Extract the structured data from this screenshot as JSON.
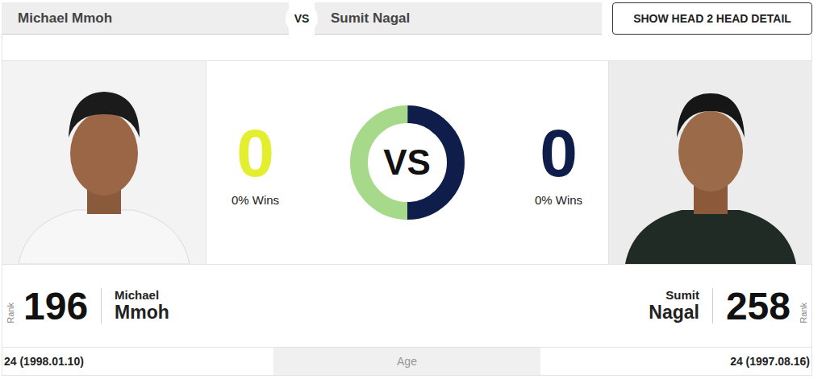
{
  "players": [
    {
      "name": "Michael Mmoh",
      "first_name": "Michael",
      "last_name": "Mmoh",
      "wins": "0",
      "win_pct": "0% Wins",
      "rank": "196",
      "age": "24 (1998.01.10)",
      "color": "#e3ef2e"
    },
    {
      "name": "Sumit Nagal",
      "first_name": "Sumit",
      "last_name": "Nagal",
      "wins": "0",
      "win_pct": "0% Wins",
      "rank": "258",
      "age": "24 (1997.08.16)",
      "color": "#0f1d4a"
    }
  ],
  "vs": "VS",
  "button": "SHOW HEAD 2 HEAD DETAIL",
  "rank_label": "Rank",
  "age_label": "Age",
  "donut": {
    "label": "VS",
    "segments": [
      {
        "level": 0.5,
        "color": "#a6d98a"
      },
      {
        "level": 0.5,
        "color": "#0f1d4a"
      }
    ]
  }
}
